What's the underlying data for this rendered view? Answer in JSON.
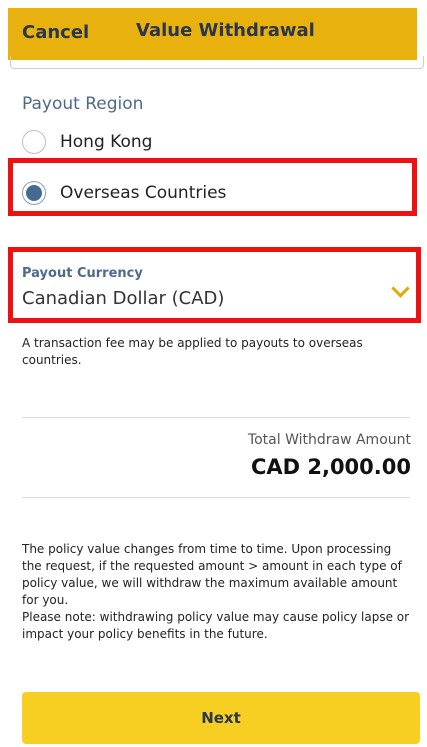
{
  "header": {
    "cancel_label": "Cancel",
    "title": "Value Withdrawal"
  },
  "payout_region": {
    "title": "Payout Region",
    "options": [
      {
        "label": "Hong Kong",
        "selected": false
      },
      {
        "label": "Overseas Countries",
        "selected": true
      }
    ]
  },
  "payout_currency": {
    "label": "Payout Currency",
    "value": "Canadian Dollar (CAD)",
    "icon": "chevron-down-icon"
  },
  "fee_note": "A transaction fee may be applied to payouts to overseas countries.",
  "total": {
    "label": "Total Withdraw Amount",
    "value": "CAD 2,000.00"
  },
  "policy_notes": [
    "The policy value changes from time to time. Upon processing the request, if the requested amount > amount in each type of policy value, we will withdraw the maximum available amount for you.",
    "Please note: withdrawing policy value may cause policy lapse or impact your policy benefits in the future."
  ],
  "next_label": "Next",
  "colors": {
    "header_bg": "#e8b10e",
    "button_bg": "#f7cf22",
    "highlight": "#ee1111",
    "accent_blue": "#456b93"
  }
}
